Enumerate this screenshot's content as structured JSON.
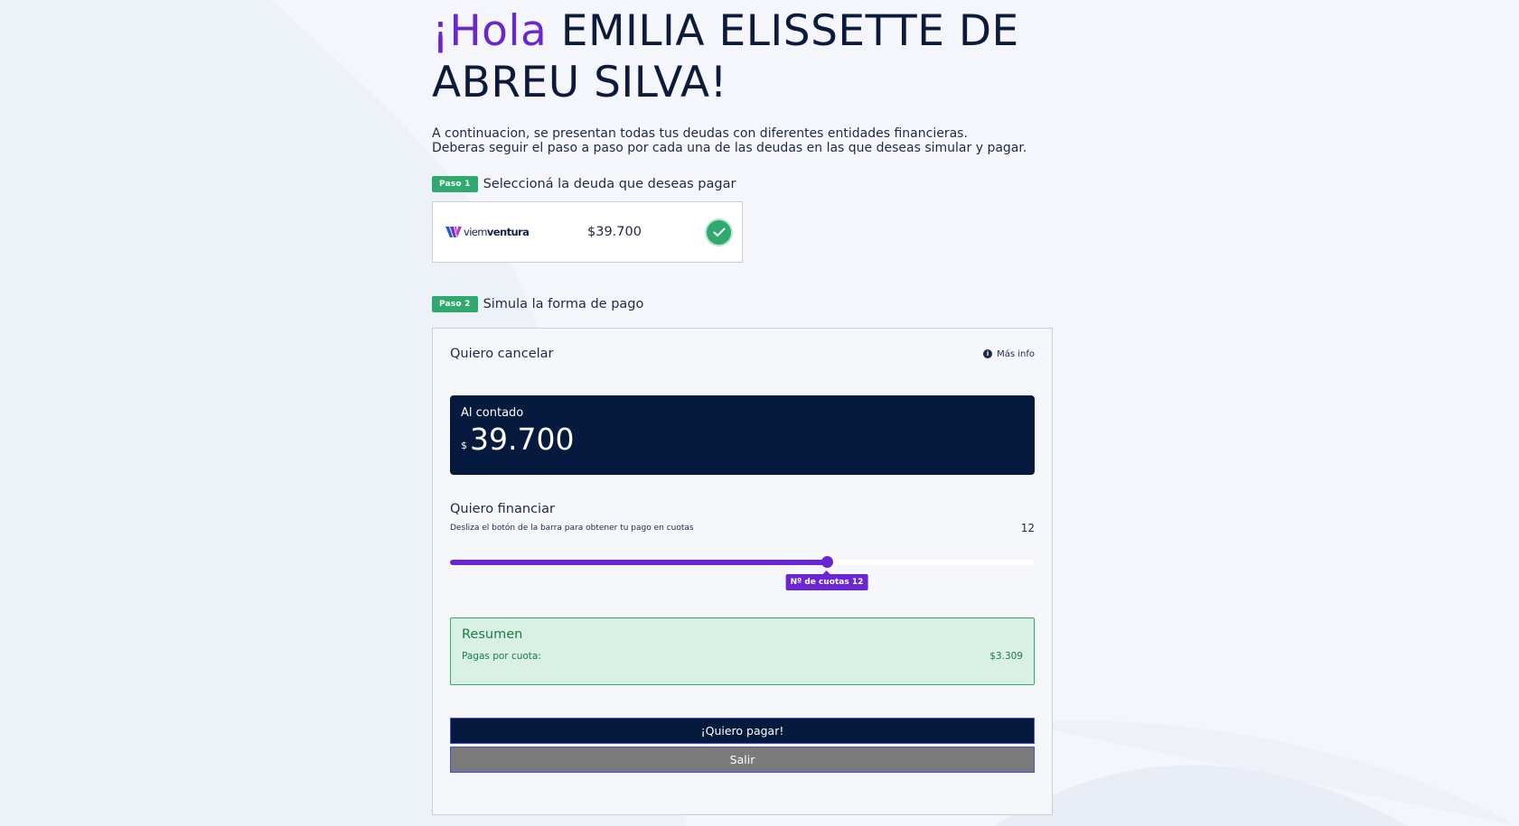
{
  "greeting": {
    "hola": "¡Hola",
    "name": "EMILIA ELISSETTE DE ABREU SILVA!"
  },
  "intro": {
    "line1": "A continuacion, se presentan todas tus deudas con diferentes entidades financieras.",
    "line2": "Deberas seguir el paso a paso por cada una de las deudas en las que deseas simular y pagar."
  },
  "step1": {
    "badge": "Paso 1",
    "label": "Seleccioná la deuda que deseas pagar"
  },
  "debt": {
    "logo_light": "viem",
    "logo_bold": "ventura",
    "amount": "$39.700",
    "selected": true
  },
  "step2": {
    "badge": "Paso 2",
    "label": "Simula la forma de pago"
  },
  "simulation": {
    "title": "Quiero cancelar",
    "more_info": "Más info",
    "cash": {
      "label": "Al contado",
      "currency": "$",
      "value": "39.700"
    },
    "finance": {
      "title": "Quiero financiar",
      "hint": "Desliza el botón de la barra para obtener tu pago en cuotas",
      "count": "12",
      "slider_fraction": 0.645,
      "tooltip": "Nº de cuotas 12"
    },
    "summary": {
      "title": "Resumen",
      "row_label": "Pagas por cuota:",
      "row_value": "$3.309"
    },
    "pay_button": "¡Quiero pagar!",
    "exit_button": "Salir"
  },
  "colors": {
    "accent": "#6a26d0",
    "navy": "#061a3d",
    "success": "#2fa96d",
    "summary_bg": "#d9f0e4",
    "exit_gray": "#7a7a7a"
  }
}
